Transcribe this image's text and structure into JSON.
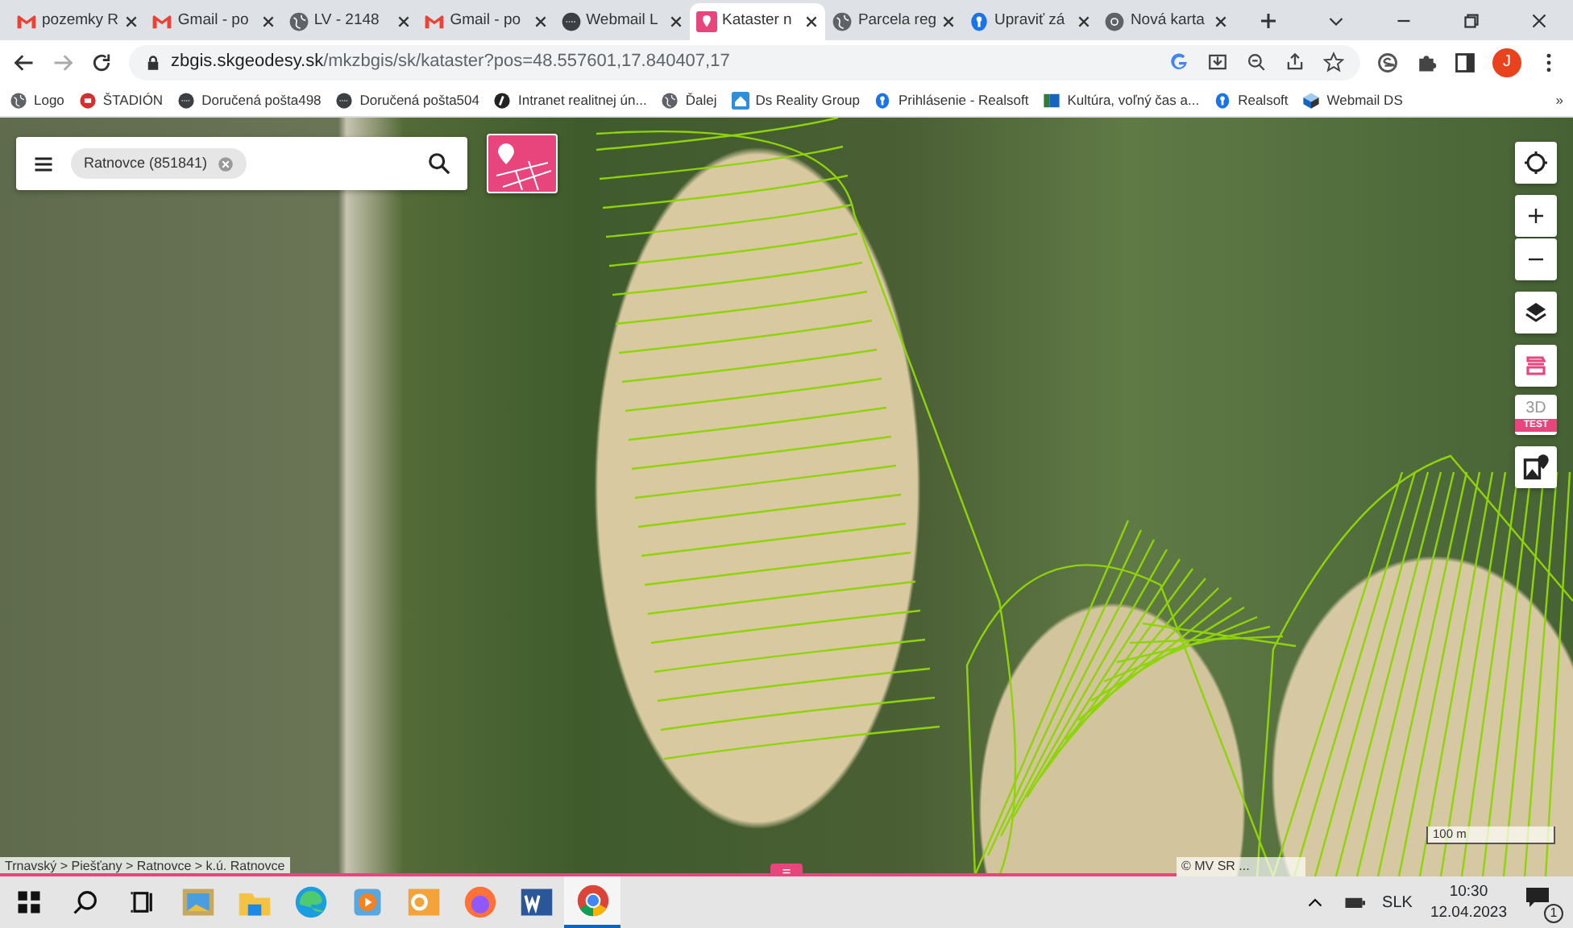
{
  "tabs": [
    {
      "kind": "gmail",
      "title": "pozemky R",
      "selected": false
    },
    {
      "kind": "gmail",
      "title": "Gmail - po",
      "selected": false
    },
    {
      "kind": "globe",
      "title": "LV - 2148",
      "selected": false
    },
    {
      "kind": "gmail",
      "title": "Gmail - po",
      "selected": false
    },
    {
      "kind": "webmail",
      "title": "Webmail L",
      "selected": false
    },
    {
      "kind": "kataster",
      "title": "Kataster n",
      "selected": true
    },
    {
      "kind": "globe",
      "title": "Parcela reg",
      "selected": false
    },
    {
      "kind": "realsoft",
      "title": "Upraviť zá",
      "selected": false
    },
    {
      "kind": "chrome",
      "title": "Nová karta",
      "selected": false
    }
  ],
  "address": {
    "host": "zbgis.skgeodesy.sk",
    "path": "/mkzbgis/sk/kataster?pos=48.557601,17.840407,17"
  },
  "profile": {
    "initial": "J"
  },
  "bookmarks": [
    {
      "kind": "globe",
      "label": "Logo"
    },
    {
      "kind": "stadion",
      "label": "ŠTADIÓN"
    },
    {
      "kind": "webmail",
      "label": "Doručená pošta498"
    },
    {
      "kind": "webmail",
      "label": "Doručená pošta504"
    },
    {
      "kind": "intranet",
      "label": "Intranet realitnej ún..."
    },
    {
      "kind": "globe",
      "label": "Ďalej"
    },
    {
      "kind": "ds",
      "label": "Ds Reality Group"
    },
    {
      "kind": "realsoft",
      "label": "Prihlásenie - Realsoft"
    },
    {
      "kind": "kultura",
      "label": "Kultúra, voľný čas a..."
    },
    {
      "kind": "realsoft",
      "label": "Realsoft"
    },
    {
      "kind": "cube",
      "label": "Webmail DS"
    }
  ],
  "bookmarks_more": "»",
  "map": {
    "search_chip": "Ratnovce (851841)",
    "badge_3d": "3D",
    "badge_test": "TEST",
    "breadcrumb": "Trnavský > Piešťany > Ratnovce > k.ú. Ratnovce",
    "scale": "100 m",
    "attribution": "© MV SR ..."
  },
  "taskbar": {
    "apps": [
      {
        "kind": "photos",
        "selected": false
      },
      {
        "kind": "explorer",
        "selected": false
      },
      {
        "kind": "edge",
        "selected": false
      },
      {
        "kind": "media",
        "selected": false
      },
      {
        "kind": "outlook",
        "selected": false
      },
      {
        "kind": "firefox",
        "selected": false
      },
      {
        "kind": "word",
        "selected": false
      },
      {
        "kind": "chrome",
        "selected": true
      }
    ],
    "language": "SLK",
    "time": "10:30",
    "date": "12.04.2023",
    "notifications": "1"
  }
}
